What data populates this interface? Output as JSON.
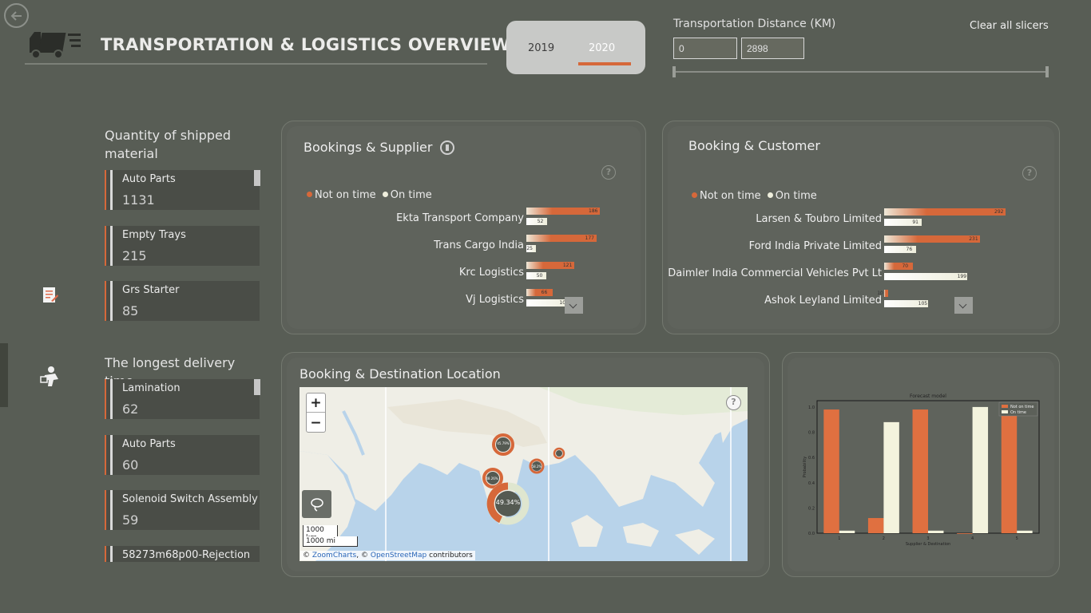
{
  "header": {
    "title": "TRANSPORTATION & LOGISTICS OVERVIEW",
    "years": [
      "2019",
      "2020"
    ],
    "selected_year": "2020",
    "distance_label": "Transportation Distance (KM)",
    "distance_min": "0",
    "distance_max": "2898",
    "clear_label": "Clear all slicers"
  },
  "shipped": {
    "label": "Quantity of shipped material",
    "items": [
      {
        "name": "Auto Parts",
        "value": "1131"
      },
      {
        "name": "Empty Trays",
        "value": "215"
      },
      {
        "name": "Grs Starter",
        "value": "85"
      }
    ]
  },
  "longest": {
    "label": "The longest delivery time",
    "items": [
      {
        "name": "Lamination",
        "value": "62"
      },
      {
        "name": "Auto Parts",
        "value": "60"
      },
      {
        "name": "Solenoid Switch Assembly",
        "value": "59"
      },
      {
        "name": "58273m68p00-Rejection",
        "value": ""
      }
    ]
  },
  "supplier": {
    "title": "Bookings & Supplier",
    "legend": {
      "not_on_time": "Not on time",
      "on_time": "On time"
    },
    "rows": [
      {
        "name": "Ekta Transport Company",
        "late": 186,
        "ontime": 52,
        "late_label": "186",
        "ontime_label": "52"
      },
      {
        "name": "Trans Cargo India",
        "late": 177,
        "ontime": 25,
        "late_label": "177",
        "ontime_label": "25"
      },
      {
        "name": "Krc Logistics",
        "late": 121,
        "ontime": 50,
        "late_label": "121",
        "ontime_label": "50"
      },
      {
        "name": "Vj Logistics",
        "late": 66,
        "ontime": 108,
        "late_label": "66",
        "ontime_label": "108"
      }
    ],
    "max": 186
  },
  "customer": {
    "title": "Booking & Customer",
    "legend": {
      "not_on_time": "Not on time",
      "on_time": "On time"
    },
    "rows": [
      {
        "name": "Larsen & Toubro Limited",
        "late": 292,
        "ontime": 91,
        "late_label": "292",
        "ontime_label": "91"
      },
      {
        "name": "Ford India Private Limited",
        "late": 231,
        "ontime": 76,
        "late_label": "231",
        "ontime_label": "76"
      },
      {
        "name": "Daimler India Commercial Vehicles Pvt Lt",
        "late": 70,
        "ontime": 199,
        "late_label": "70",
        "ontime_label": "199"
      },
      {
        "name": "Ashok Leyland Limited",
        "late": 10,
        "ontime": 105,
        "late_label": "10",
        "ontime_label": "105"
      }
    ],
    "max": 292
  },
  "map": {
    "title": "Booking & Destination Location",
    "main_label": "49.34%",
    "scale_km": "1000 km",
    "scale_mi": "1000 mi",
    "attribution_prefix": "©",
    "attribution_zc": "ZoomCharts",
    "attribution_mid": ", ©",
    "attribution_osm": "OpenStreetMap",
    "attribution_suffix": "contributors",
    "zoom_in": "+",
    "zoom_out": "−"
  },
  "chart_data": {
    "type": "bar",
    "title": "Forecast model",
    "xlabel": "Supplier & Destination",
    "ylabel": "Probability",
    "categories": [
      "1",
      "2",
      "3",
      "4",
      "5"
    ],
    "series": [
      {
        "name": "Not on time",
        "values": [
          0.98,
          0.12,
          0.98,
          0.0,
          0.98
        ],
        "color": "#e07040"
      },
      {
        "name": "On time",
        "values": [
          0.02,
          0.88,
          0.02,
          1.0,
          0.02
        ],
        "color": "#f3f3dd"
      }
    ],
    "ylim": [
      0,
      1.05
    ],
    "yticks": [
      "0.0",
      "0.2",
      "0.4",
      "0.6",
      "0.8",
      "1.0"
    ],
    "legend": "top-right"
  },
  "colors": {
    "accent": "#d6683a",
    "ontime": "#eeeedc",
    "bg": "#585d55"
  }
}
